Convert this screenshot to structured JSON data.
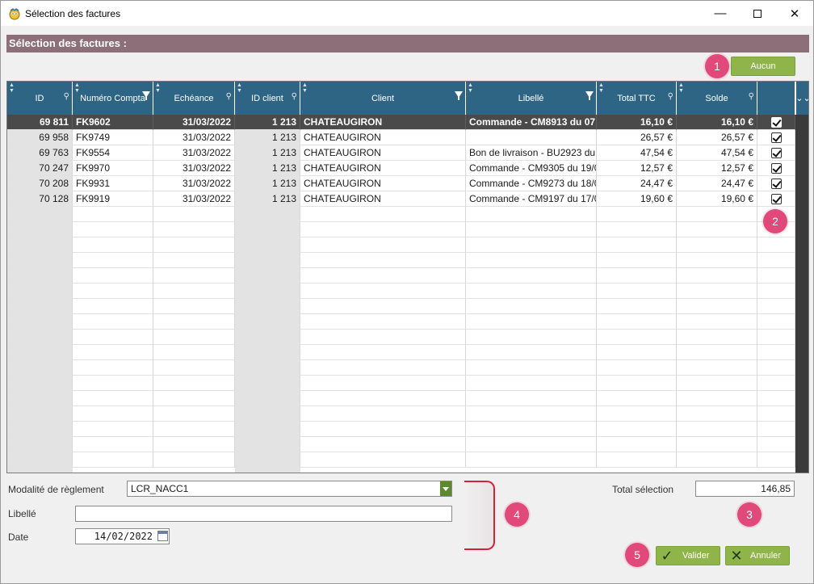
{
  "window": {
    "title": "Sélection des factures",
    "minimize": "—",
    "close": "✕"
  },
  "section_title": "Sélection des factures :",
  "aucun_button": "Aucun",
  "badges": [
    "1",
    "2",
    "3",
    "4",
    "5"
  ],
  "columns": [
    {
      "label": "ID",
      "marker": "key"
    },
    {
      "label": "Numéro Compta",
      "marker": "filter"
    },
    {
      "label": "Echéance",
      "marker": "key"
    },
    {
      "label": "ID client",
      "marker": "key"
    },
    {
      "label": "Client",
      "marker": "filter"
    },
    {
      "label": "Libellé",
      "marker": "filter"
    },
    {
      "label": "Total TTC",
      "marker": "key"
    },
    {
      "label": "Solde",
      "marker": "key"
    },
    {
      "label": "",
      "marker": "none"
    }
  ],
  "rows": [
    {
      "id": "69 811",
      "compta": "FK9602",
      "echeance": "31/03/2022",
      "client_id": "1 213",
      "client": "CHATEAUGIRON",
      "libelle": "Commande - CM8913 du 07",
      "ttc": "16,10 €",
      "solde": "16,10 €",
      "checked": true,
      "selected": true
    },
    {
      "id": "69 958",
      "compta": "FK9749",
      "echeance": "31/03/2022",
      "client_id": "1 213",
      "client": "CHATEAUGIRON",
      "libelle": "",
      "ttc": "26,57 €",
      "solde": "26,57 €",
      "checked": true,
      "selected": false
    },
    {
      "id": "69 763",
      "compta": "FK9554",
      "echeance": "31/03/2022",
      "client_id": "1 213",
      "client": "CHATEAUGIRON",
      "libelle": "Bon de livraison - BU2923 du",
      "ttc": "47,54 €",
      "solde": "47,54 €",
      "checked": true,
      "selected": false
    },
    {
      "id": "70 247",
      "compta": "FK9970",
      "echeance": "31/03/2022",
      "client_id": "1 213",
      "client": "CHATEAUGIRON",
      "libelle": "Commande - CM9305 du 19/0",
      "ttc": "12,57 €",
      "solde": "12,57 €",
      "checked": true,
      "selected": false
    },
    {
      "id": "70 208",
      "compta": "FK9931",
      "echeance": "31/03/2022",
      "client_id": "1 213",
      "client": "CHATEAUGIRON",
      "libelle": "Commande - CM9273 du 18/0",
      "ttc": "24,47 €",
      "solde": "24,47 €",
      "checked": true,
      "selected": false
    },
    {
      "id": "70 128",
      "compta": "FK9919",
      "echeance": "31/03/2022",
      "client_id": "1 213",
      "client": "CHATEAUGIRON",
      "libelle": "Commande - CM9197 du 17/0",
      "ttc": "19,60 €",
      "solde": "19,60 €",
      "checked": true,
      "selected": false
    }
  ],
  "form": {
    "modalite_label": "Modalité de règlement",
    "modalite_value": "LCR_NACC1",
    "libelle_label": "Libellé",
    "libelle_value": "",
    "date_label": "Date",
    "date_value": "14/02/2022",
    "total_label": "Total sélection",
    "total_value": "146,85"
  },
  "buttons": {
    "valider": "Valider",
    "annuler": "Annuler"
  },
  "colors": {
    "header_band": "#8d6f7a",
    "grid_header": "#2f6584",
    "accent_green": "#8fb44a",
    "badge": "#e0497a",
    "bracket": "#d9203a"
  }
}
